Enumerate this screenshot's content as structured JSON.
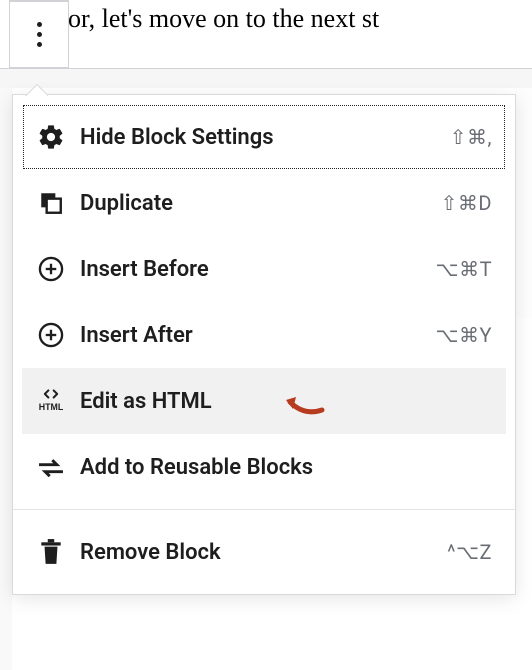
{
  "background_text": "or, let's move on to the next st",
  "menu": {
    "items": [
      {
        "icon": "gear",
        "label": "Hide Block Settings",
        "shortcut": "⇧⌘,",
        "focused": true
      },
      {
        "icon": "duplicate",
        "label": "Duplicate",
        "shortcut": "⇧⌘D"
      },
      {
        "icon": "insert-before",
        "label": "Insert Before",
        "shortcut": "⌥⌘T"
      },
      {
        "icon": "insert-after",
        "label": "Insert After",
        "shortcut": "⌥⌘Y"
      },
      {
        "icon": "html",
        "label": "Edit as HTML",
        "shortcut": "",
        "hovered": true,
        "annotated": true
      },
      {
        "icon": "reusable",
        "label": "Add to Reusable Blocks",
        "shortcut": ""
      },
      {
        "icon": "trash",
        "label": "Remove Block",
        "shortcut": "^⌥Z"
      }
    ]
  }
}
